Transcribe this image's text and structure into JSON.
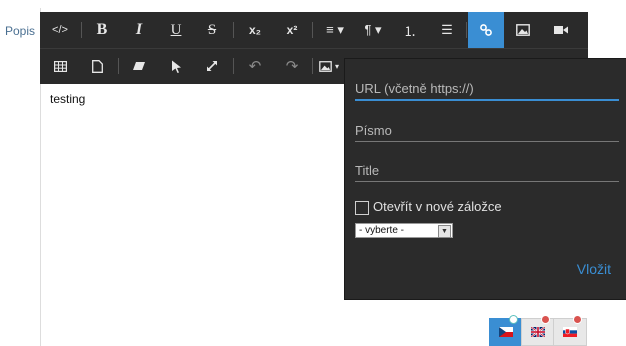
{
  "field_label": "Popis",
  "content_text": "testing",
  "toolbar": {
    "row1": [
      {
        "name": "code-view-button",
        "icon": "code-icon",
        "glyph": "</>"
      },
      {
        "name": "bold-button",
        "icon": "bold-icon",
        "glyph": "B"
      },
      {
        "name": "italic-button",
        "icon": "italic-icon",
        "glyph": "I"
      },
      {
        "name": "underline-button",
        "icon": "underline-icon",
        "glyph": "U"
      },
      {
        "name": "strikethrough-button",
        "icon": "strikethrough-icon",
        "glyph": "S"
      },
      {
        "name": "subscript-button",
        "icon": "subscript-icon",
        "glyph": "x₂"
      },
      {
        "name": "superscript-button",
        "icon": "superscript-icon",
        "glyph": "x²"
      },
      {
        "name": "align-dropdown-button",
        "icon": "align-left-icon",
        "glyph": "≡ ▾"
      },
      {
        "name": "paragraph-format-button",
        "icon": "paragraph-icon",
        "glyph": "¶ ▾"
      },
      {
        "name": "ordered-list-button",
        "icon": "ordered-list-icon",
        "glyph": "⒈"
      },
      {
        "name": "unordered-list-button",
        "icon": "unordered-list-icon",
        "glyph": "☰"
      },
      {
        "name": "insert-link-button",
        "icon": "link-icon",
        "glyph": "🔗"
      },
      {
        "name": "insert-image-button",
        "icon": "image-icon",
        "glyph": "▣"
      },
      {
        "name": "insert-video-button",
        "icon": "video-icon",
        "glyph": "■"
      }
    ],
    "row2": [
      {
        "name": "insert-table-button",
        "icon": "table-icon",
        "glyph": "▦"
      },
      {
        "name": "insert-file-button",
        "icon": "file-icon",
        "glyph": "▢"
      },
      {
        "name": "clear-formatting-button",
        "icon": "eraser-icon",
        "glyph": "▱"
      },
      {
        "name": "select-all-button",
        "icon": "cursor-icon",
        "glyph": "➤"
      },
      {
        "name": "fullscreen-button",
        "icon": "expand-icon",
        "glyph": "⤢"
      },
      {
        "name": "undo-button",
        "icon": "undo-icon",
        "glyph": "↶"
      },
      {
        "name": "redo-button",
        "icon": "redo-icon",
        "glyph": "↷"
      },
      {
        "name": "image-manager-button",
        "icon": "image-icon",
        "glyph": "▣ ▾"
      }
    ]
  },
  "link_popup": {
    "url_placeholder": "URL (včetně https://)",
    "text_placeholder": "Písmo",
    "title_placeholder": "Title",
    "open_new_tab_label": "Otevřít v nové záložce",
    "select_value": "- vyberte -",
    "insert_label": "Vložit"
  },
  "languages": [
    {
      "name": "language-tab-cz",
      "icon": "flag-cz-icon",
      "active": true
    },
    {
      "name": "language-tab-en",
      "icon": "flag-gb-icon",
      "active": false
    },
    {
      "name": "language-tab-sk",
      "icon": "flag-sk-icon",
      "active": false
    }
  ],
  "colors": {
    "accent": "#3a8ed3",
    "toolbar_bg": "#2a2a2a",
    "popup_bg": "#2b2b2b"
  }
}
